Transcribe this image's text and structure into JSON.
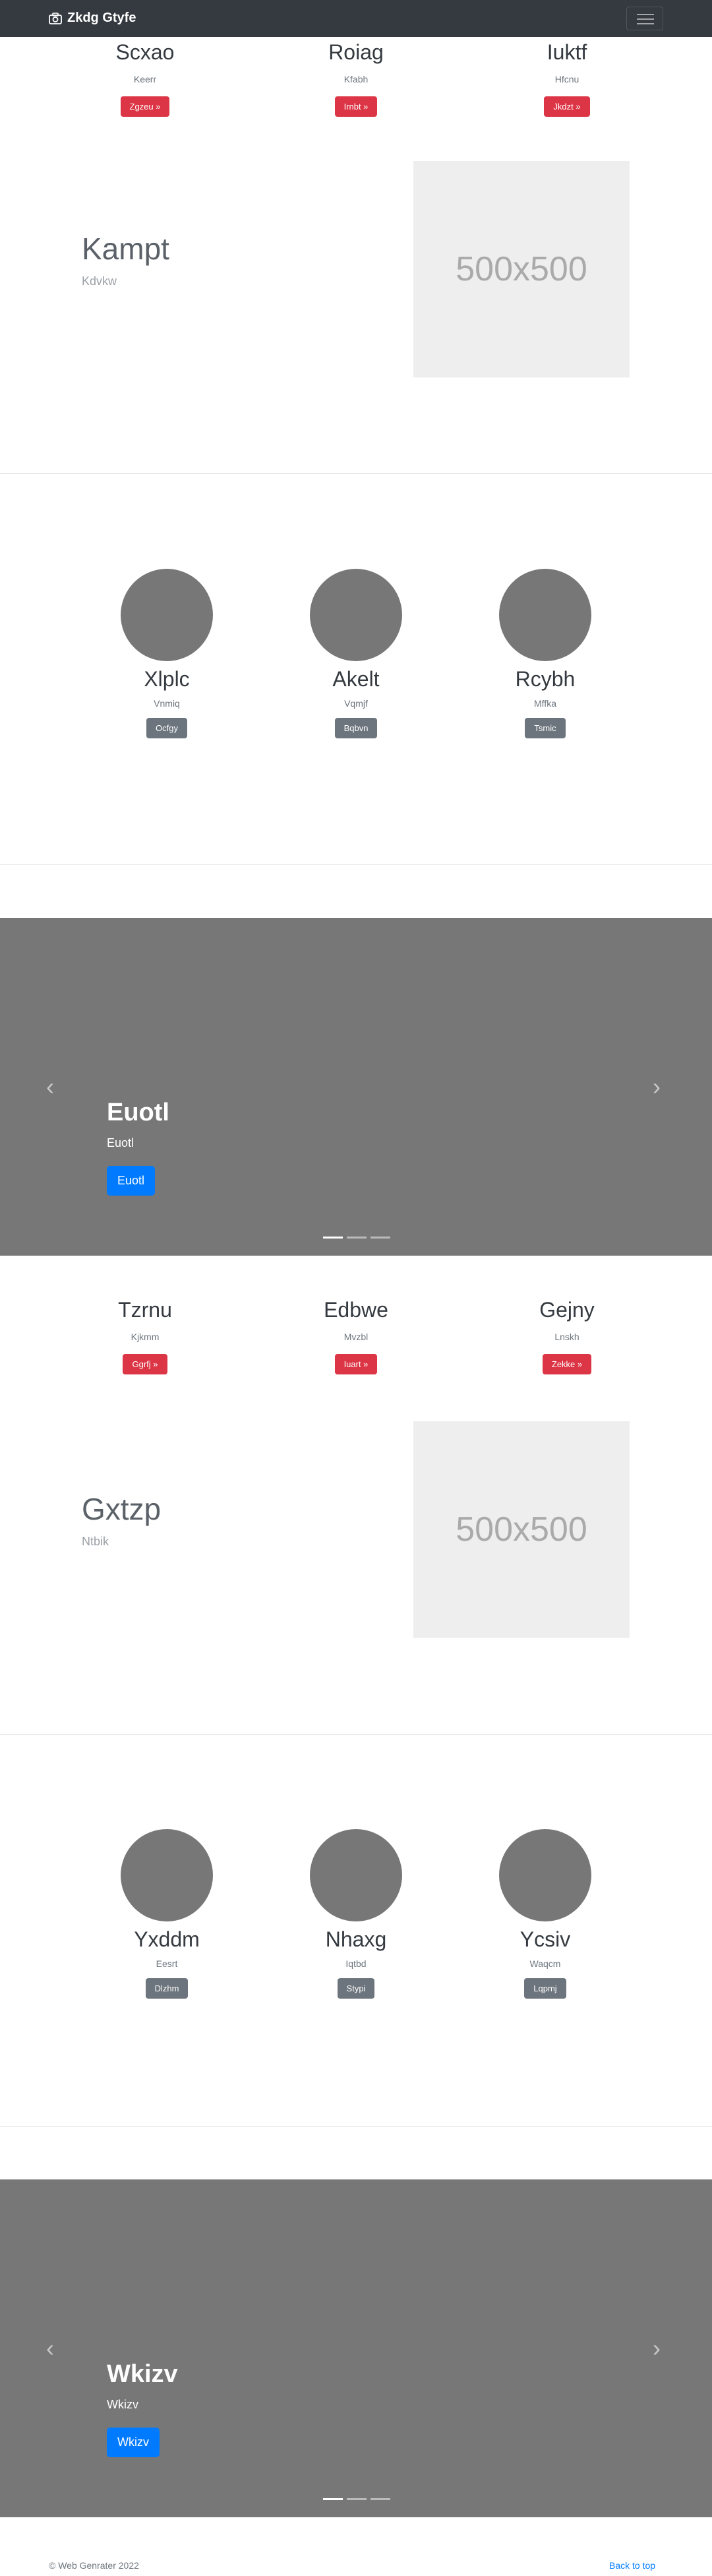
{
  "navbar": {
    "brand": "Zkdg Gtyfe",
    "brand_icon": "camera-icon",
    "toggle_icon": "hamburger-icon"
  },
  "section1": {
    "cols": [
      {
        "title": "Scxao",
        "text": "Keerr",
        "button": "Zgzeu »"
      },
      {
        "title": "Roiag",
        "text": "Kfabh",
        "button": "Irnbt »"
      },
      {
        "title": "Iuktf",
        "text": "Hfcnu",
        "button": "Jkdzt »"
      }
    ]
  },
  "feature1": {
    "title": "Kampt",
    "subtitle": "Kdvkw",
    "placeholder": "500x500"
  },
  "people1": {
    "cols": [
      {
        "name": "Xlplc",
        "text": "Vnmiq",
        "button": "Ocfgy"
      },
      {
        "name": "Akelt",
        "text": "Vqmjf",
        "button": "Bqbvn"
      },
      {
        "name": "Rcybh",
        "text": "Mffka",
        "button": "Tsmic"
      }
    ]
  },
  "carousel1": {
    "title": "Euotl",
    "text": "Euotl",
    "button": "Euotl",
    "prev_icon": "chevron-left-icon",
    "next_icon": "chevron-right-icon"
  },
  "section2": {
    "cols": [
      {
        "title": "Tzrnu",
        "text": "Kjkmm",
        "button": "Ggrfj »"
      },
      {
        "title": "Edbwe",
        "text": "Mvzbl",
        "button": "Iuart »"
      },
      {
        "title": "Gejny",
        "text": "Lnskh",
        "button": "Zekke »"
      }
    ]
  },
  "feature2": {
    "title": "Gxtzp",
    "subtitle": "Ntbik",
    "placeholder": "500x500"
  },
  "people2": {
    "cols": [
      {
        "name": "Yxddm",
        "text": "Eesrt",
        "button": "Dlzhm"
      },
      {
        "name": "Nhaxg",
        "text": "Iqtbd",
        "button": "Stypi"
      },
      {
        "name": "Ycsiv",
        "text": "Waqcm",
        "button": "Lqpmj"
      }
    ]
  },
  "carousel2": {
    "title": "Wkizv",
    "text": "Wkizv",
    "button": "Wkizv",
    "prev_icon": "chevron-left-icon",
    "next_icon": "chevron-right-icon"
  },
  "footer": {
    "copyright": "© Web Genrater 2022",
    "back_to_top": "Back to top"
  }
}
